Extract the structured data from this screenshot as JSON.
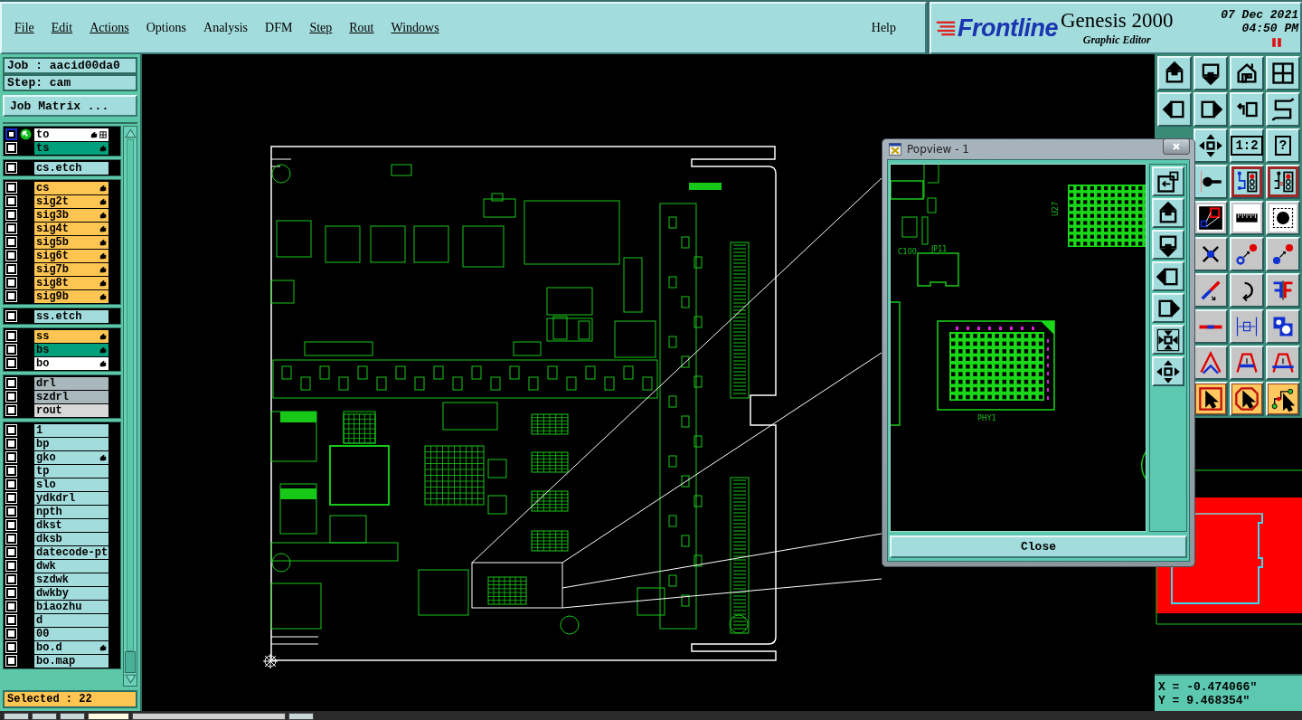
{
  "menu": {
    "items": [
      {
        "label": "File",
        "underlined": true
      },
      {
        "label": "Edit",
        "underlined": true
      },
      {
        "label": "Actions",
        "underlined": true
      },
      {
        "label": "Options",
        "underlined": false
      },
      {
        "label": "Analysis",
        "underlined": false
      },
      {
        "label": "DFM",
        "underlined": false
      },
      {
        "label": "Step",
        "underlined": true
      },
      {
        "label": "Rout",
        "underlined": true
      },
      {
        "label": "Windows",
        "underlined": true
      }
    ],
    "help": {
      "label": "Help",
      "underlined": false
    }
  },
  "header": {
    "brand": "Frontline",
    "product": "Genesis 2000",
    "subtitle": "Graphic Editor",
    "date": "07 Dec 2021",
    "time": "04:50 PM"
  },
  "job_panel": {
    "job": "Job : aacid00da0",
    "step": "Step: cam",
    "matrix_button": "Job Matrix ...",
    "layer_groups": [
      [
        {
          "name": "to",
          "color": "#ffffff",
          "hand": true,
          "work": true,
          "selected": true
        },
        {
          "name": "ts",
          "color": "#00a07c",
          "hand": true,
          "work": false,
          "selected": false
        }
      ],
      [
        {
          "name": "cs.etch",
          "color": "#a3dcdc",
          "hand": false,
          "work": false,
          "selected": false
        }
      ],
      [
        {
          "name": "cs",
          "color": "#ffc552",
          "hand": true,
          "work": false,
          "selected": false
        },
        {
          "name": "sig2t",
          "color": "#ffc552",
          "hand": true,
          "work": false,
          "selected": false
        },
        {
          "name": "sig3b",
          "color": "#ffc552",
          "hand": true,
          "work": false,
          "selected": false
        },
        {
          "name": "sig4t",
          "color": "#ffc552",
          "hand": true,
          "work": false,
          "selected": false
        },
        {
          "name": "sig5b",
          "color": "#ffc552",
          "hand": true,
          "work": false,
          "selected": false
        },
        {
          "name": "sig6t",
          "color": "#ffc552",
          "hand": true,
          "work": false,
          "selected": false
        },
        {
          "name": "sig7b",
          "color": "#ffc552",
          "hand": true,
          "work": false,
          "selected": false
        },
        {
          "name": "sig8t",
          "color": "#ffc552",
          "hand": true,
          "work": false,
          "selected": false
        },
        {
          "name": "sig9b",
          "color": "#ffc552",
          "hand": true,
          "work": false,
          "selected": false
        }
      ],
      [
        {
          "name": "ss.etch",
          "color": "#a3dcdc",
          "hand": false,
          "work": false,
          "selected": false
        }
      ],
      [
        {
          "name": "ss",
          "color": "#ffc552",
          "hand": true,
          "work": false,
          "selected": false
        },
        {
          "name": "bs",
          "color": "#00a07c",
          "hand": true,
          "work": false,
          "selected": false
        },
        {
          "name": "bo",
          "color": "#ffffff",
          "hand": true,
          "work": false,
          "selected": false
        }
      ],
      [
        {
          "name": "drl",
          "color": "#a8b8bc",
          "hand": false,
          "work": false,
          "selected": false
        },
        {
          "name": "szdrl",
          "color": "#a8b8bc",
          "hand": false,
          "work": false,
          "selected": false
        },
        {
          "name": "rout",
          "color": "#d8d8d8",
          "hand": false,
          "work": false,
          "selected": false
        }
      ],
      [
        {
          "name": "1",
          "color": "#a3dcdc",
          "hand": false,
          "work": false,
          "selected": false
        },
        {
          "name": "bp",
          "color": "#a3dcdc",
          "hand": false,
          "work": false,
          "selected": false
        },
        {
          "name": "gko",
          "color": "#a3dcdc",
          "hand": true,
          "work": false,
          "selected": false
        },
        {
          "name": "tp",
          "color": "#a3dcdc",
          "hand": false,
          "work": false,
          "selected": false
        },
        {
          "name": "slo",
          "color": "#a3dcdc",
          "hand": false,
          "work": false,
          "selected": false
        },
        {
          "name": "ydkdrl",
          "color": "#a3dcdc",
          "hand": false,
          "work": false,
          "selected": false
        },
        {
          "name": "npth",
          "color": "#a3dcdc",
          "hand": false,
          "work": false,
          "selected": false
        },
        {
          "name": "dkst",
          "color": "#a3dcdc",
          "hand": false,
          "work": false,
          "selected": false
        },
        {
          "name": "dksb",
          "color": "#a3dcdc",
          "hand": false,
          "work": false,
          "selected": false
        },
        {
          "name": "datecode-pt",
          "color": "#a3dcdc",
          "hand": false,
          "work": false,
          "selected": false
        },
        {
          "name": "dwk",
          "color": "#a3dcdc",
          "hand": false,
          "work": false,
          "selected": false
        },
        {
          "name": "szdwk",
          "color": "#a3dcdc",
          "hand": false,
          "work": false,
          "selected": false
        },
        {
          "name": "dwkby",
          "color": "#a3dcdc",
          "hand": false,
          "work": false,
          "selected": false
        },
        {
          "name": "biaozhu",
          "color": "#a3dcdc",
          "hand": false,
          "work": false,
          "selected": false
        },
        {
          "name": "d",
          "color": "#a3dcdc",
          "hand": false,
          "work": false,
          "selected": false
        },
        {
          "name": "00",
          "color": "#a3dcdc",
          "hand": false,
          "work": false,
          "selected": false
        },
        {
          "name": "bo.d",
          "color": "#a3dcdc",
          "hand": true,
          "work": false,
          "selected": false
        },
        {
          "name": "bo.map",
          "color": "#a3dcdc",
          "hand": false,
          "work": false,
          "selected": false
        }
      ]
    ],
    "selected_count": "Selected : 22"
  },
  "toolbar": {
    "rows": [
      [
        {
          "kind": "up-box"
        },
        {
          "kind": "down-box"
        },
        {
          "kind": "home"
        },
        {
          "kind": "grid"
        }
      ],
      [
        {
          "kind": "left-box"
        },
        {
          "kind": "right-box"
        },
        {
          "kind": "undo-box"
        },
        {
          "kind": "s-route"
        }
      ],
      [
        {
          "kind": "move"
        },
        {
          "kind": "text",
          "label": "1:2"
        },
        {
          "kind": "text",
          "label": "?"
        }
      ],
      [
        {
          "kind": "pin"
        },
        {
          "kind": "net"
        },
        {
          "kind": "net-alt"
        }
      ],
      [
        {
          "kind": "snap"
        },
        {
          "kind": "ruler"
        },
        {
          "kind": "pad"
        }
      ],
      [
        {
          "kind": "cross"
        },
        {
          "kind": "link-hollow"
        },
        {
          "kind": "link-solid"
        }
      ],
      [
        {
          "kind": "slash"
        },
        {
          "kind": "rotate"
        },
        {
          "kind": "mirror"
        }
      ],
      [
        {
          "kind": "segment"
        },
        {
          "kind": "measure"
        },
        {
          "kind": "shapes"
        }
      ],
      [
        {
          "kind": "arc-a"
        },
        {
          "kind": "arc-b"
        },
        {
          "kind": "arc-c"
        }
      ],
      [
        {
          "kind": "select"
        },
        {
          "kind": "select-poly"
        },
        {
          "kind": "route-select"
        }
      ]
    ]
  },
  "popview": {
    "title": "Popview - 1",
    "labels": [
      {
        "text": "U27"
      },
      {
        "text": "C100"
      },
      {
        "text": "JP11"
      },
      {
        "text": "PHY1"
      }
    ],
    "tools": [
      {
        "kind": "fit-box"
      },
      {
        "kind": "up-box"
      },
      {
        "kind": "down-box"
      },
      {
        "kind": "left-box"
      },
      {
        "kind": "right-box"
      },
      {
        "kind": "zoom-in"
      },
      {
        "kind": "move"
      }
    ],
    "close_button": "Close"
  },
  "coordinates": {
    "x": "X = -0.474066\"",
    "y": "Y = 9.468354\""
  }
}
